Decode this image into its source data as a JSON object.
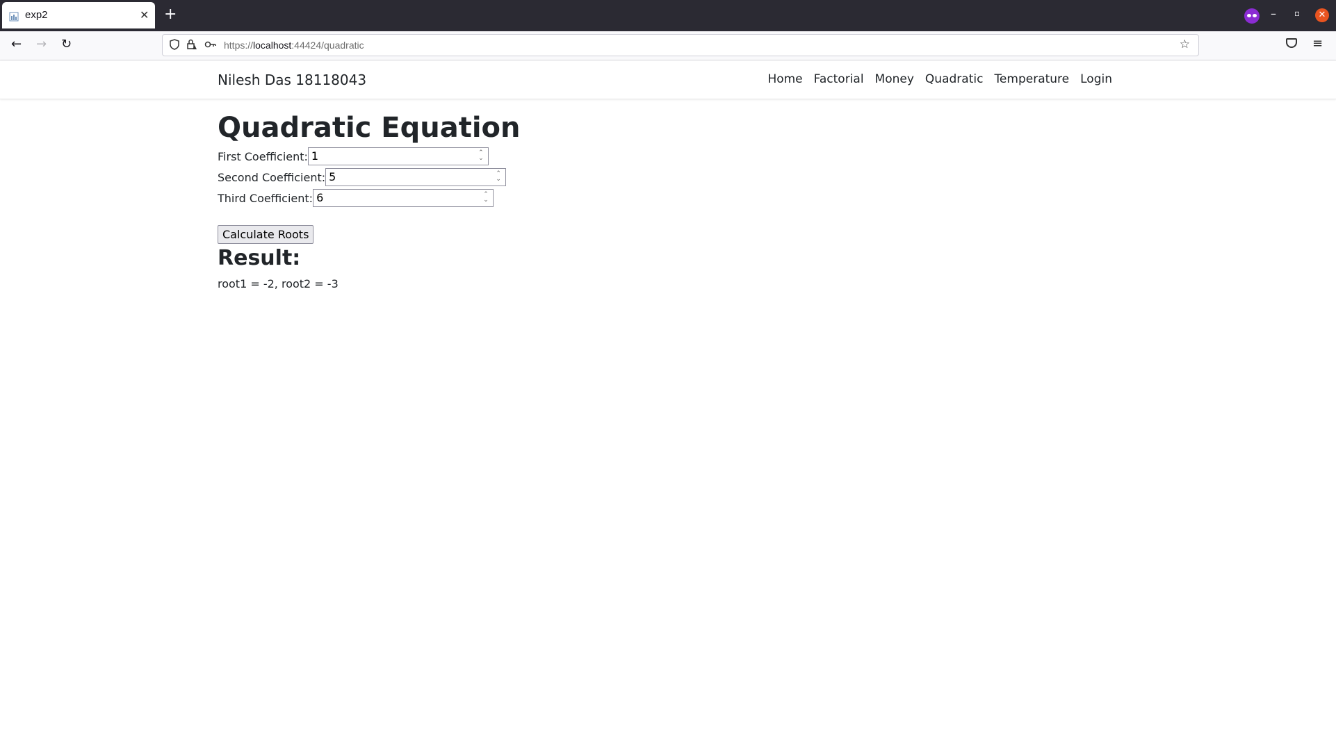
{
  "browser": {
    "tab_title": "exp2",
    "tab_close": "✕",
    "new_tab": "+",
    "url_scheme": "https://",
    "url_host": "localhost",
    "url_rest": ":44424/quadratic",
    "win_min": "–",
    "win_max": "▫",
    "win_close": "✕",
    "back": "←",
    "forward": "→",
    "reload": "↻",
    "star": "☆",
    "menu": "≡"
  },
  "site": {
    "brand": "Nilesh Das 18118043",
    "nav": [
      "Home",
      "Factorial",
      "Money",
      "Quadratic",
      "Temperature",
      "Login"
    ]
  },
  "page": {
    "title": "Quadratic Equation",
    "fields": [
      {
        "label": "First Coefficient:",
        "value": "1"
      },
      {
        "label": "Second Coefficient:",
        "value": "5"
      },
      {
        "label": "Third Coefficient:",
        "value": "6"
      }
    ],
    "button": "Calculate Roots",
    "result_heading": "Result:",
    "result_text": "root1 = -2, root2 = -3"
  }
}
